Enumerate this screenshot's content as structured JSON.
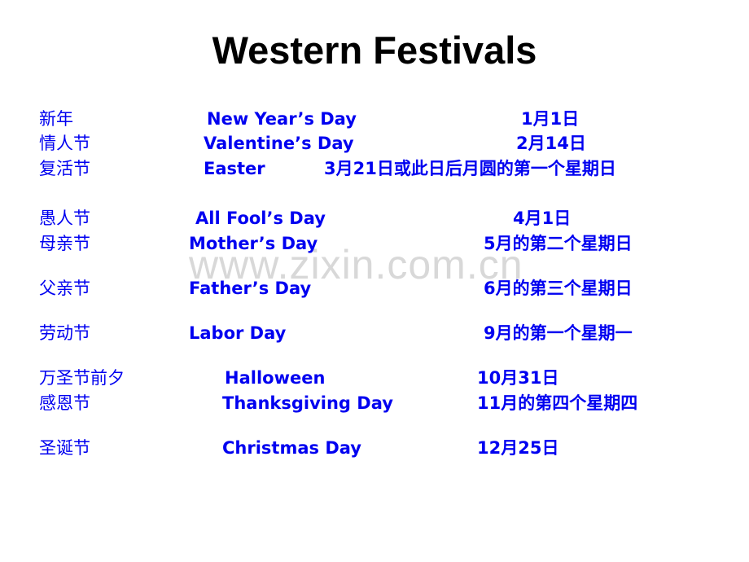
{
  "title": "Western Festivals",
  "watermark": "www.zixin.com.cn",
  "text_color": "#0000f0",
  "festivals": [
    {
      "cn": "新年",
      "en": "New Year’s Day",
      "date": "1月1日"
    },
    {
      "cn": "情人节",
      "en": "Valentine’s Day",
      "date": "2月14日"
    },
    {
      "cn": "复活节",
      "en": "Easter",
      "date": "3月21日或此日后月圆的第一个星期日"
    },
    {
      "cn": "愚人节",
      "en": "All Fool’s Day",
      "date": "4月1日"
    },
    {
      "cn": "母亲节",
      "en": "Mother’s Day",
      "date": "5月的第二个星期日"
    },
    {
      "cn": "父亲节",
      "en": "Father’s Day",
      "date": "6月的第三个星期日"
    },
    {
      "cn": "劳动节",
      "en": "Labor Day",
      "date": "9月的第一个星期一"
    },
    {
      "cn": "万圣节前夕",
      "en": "Halloween",
      "date": "10月31日"
    },
    {
      "cn": "感恩节",
      "en": "Thanksgiving Day",
      "date": "11月的第四个星期四"
    },
    {
      "cn": "圣诞节",
      "en": "Christmas Day",
      "date": "12月25日"
    }
  ]
}
